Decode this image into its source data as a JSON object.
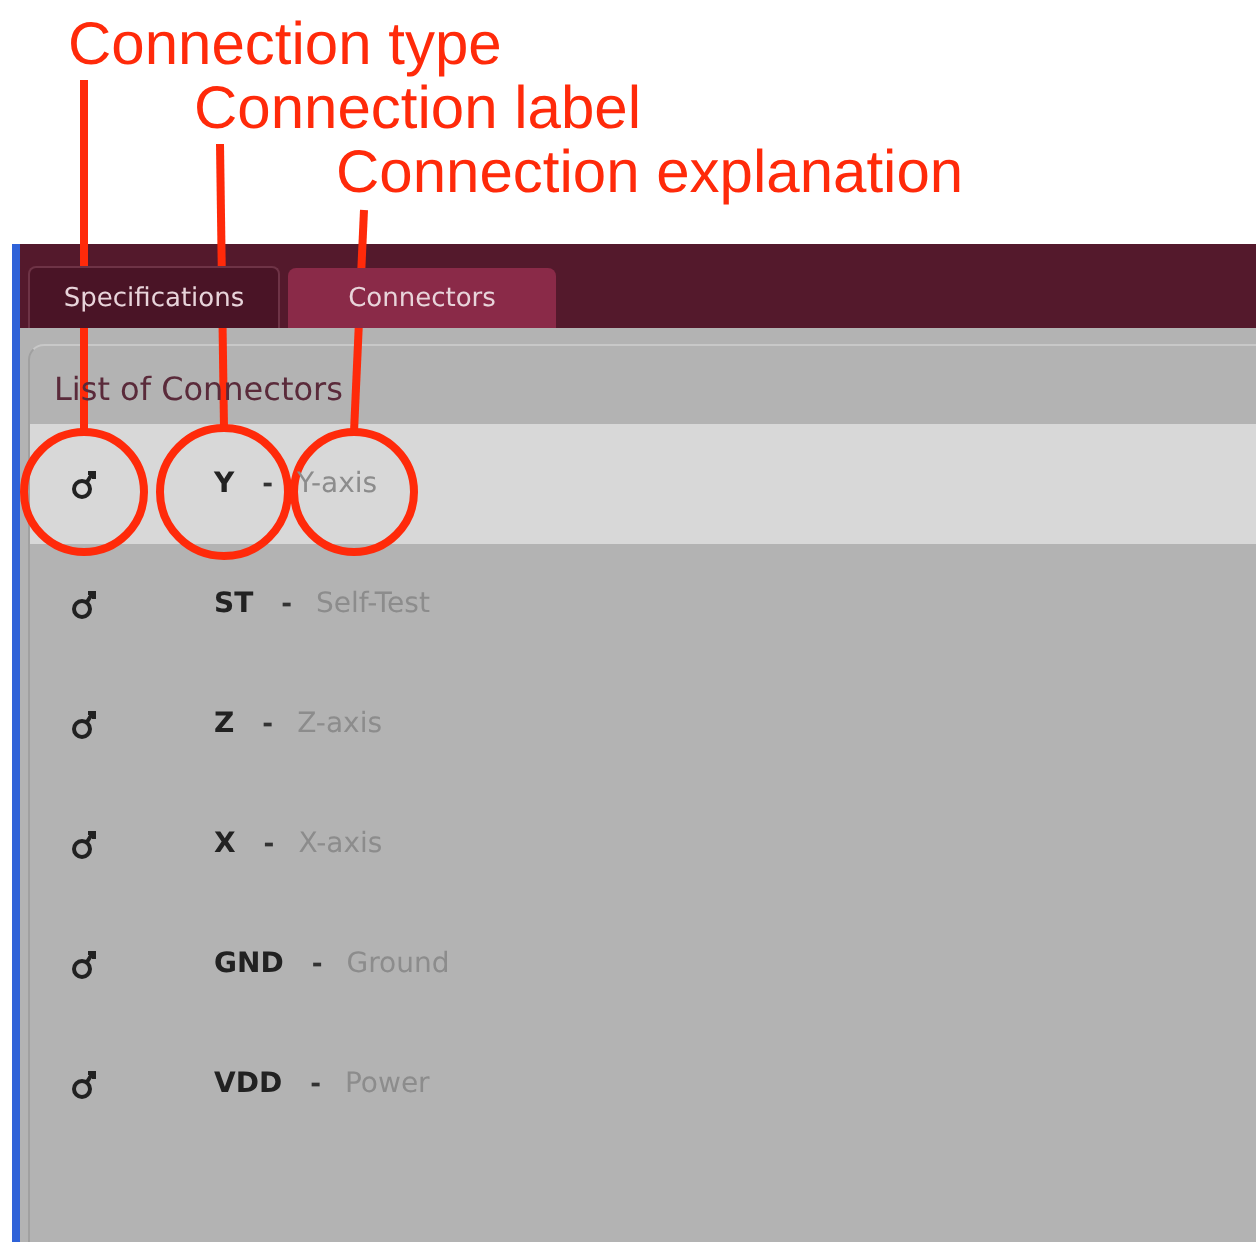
{
  "annotations": [
    {
      "text": "Connection type"
    },
    {
      "text": "Connection label"
    },
    {
      "text": "Connection explanation"
    }
  ],
  "tabs": [
    {
      "label": "Specifications",
      "selected": false
    },
    {
      "label": "Connectors",
      "selected": true
    }
  ],
  "panel": {
    "title": "List of Connectors"
  },
  "connectors": [
    {
      "label": "Y",
      "separator": "-",
      "explanation": "Y-axis",
      "selected": true
    },
    {
      "label": "ST",
      "separator": "-",
      "explanation": "Self-Test",
      "selected": false
    },
    {
      "label": "Z",
      "separator": "-",
      "explanation": "Z-axis",
      "selected": false
    },
    {
      "label": "X",
      "separator": "-",
      "explanation": "X-axis",
      "selected": false
    },
    {
      "label": "GND",
      "separator": "-",
      "explanation": "Ground",
      "selected": false
    },
    {
      "label": "VDD",
      "separator": "-",
      "explanation": "Power",
      "selected": false
    }
  ]
}
